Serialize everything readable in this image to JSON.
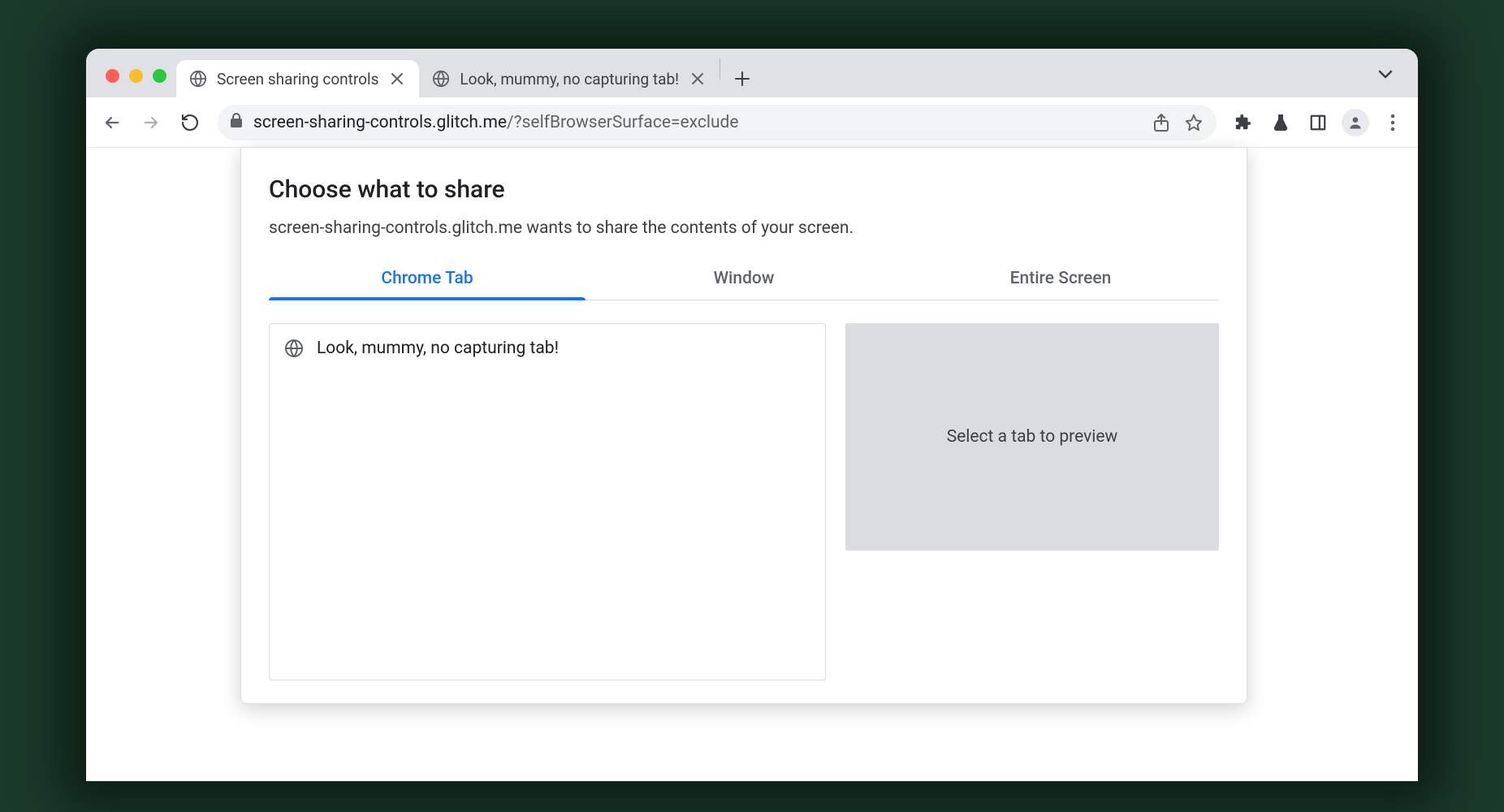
{
  "browser": {
    "tabs": [
      {
        "title": "Screen sharing controls",
        "active": true,
        "icon": "globe"
      },
      {
        "title": "Look, mummy, no capturing tab!",
        "active": false,
        "icon": "globe"
      }
    ],
    "url_host": "screen-sharing-controls.glitch.me",
    "url_path": "/?selfBrowserSurface=exclude"
  },
  "dialog": {
    "title": "Choose what to share",
    "subtitle": "screen-sharing-controls.glitch.me wants to share the contents of your screen.",
    "tab_labels": {
      "chrome_tab": "Chrome Tab",
      "window": "Window",
      "entire_screen": "Entire Screen"
    },
    "tab_entries": [
      {
        "title": "Look, mummy, no capturing tab!",
        "icon": "globe"
      }
    ],
    "preview_placeholder": "Select a tab to preview"
  }
}
